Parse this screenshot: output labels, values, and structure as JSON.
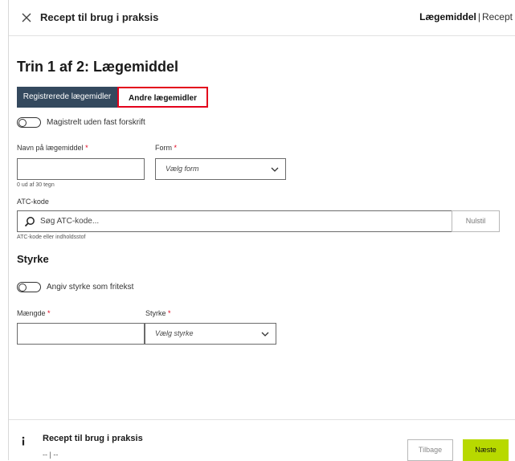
{
  "header": {
    "title": "Recept til brug i praksis",
    "crumb_active": "Lægemiddel",
    "crumb_separator": "|",
    "crumb_next": "Recept"
  },
  "step": {
    "title": "Trin 1 af 2: Lægemiddel"
  },
  "tabs": [
    {
      "label": "Registrerede lægemidler",
      "active": true
    },
    {
      "label": "Andre lægemidler",
      "active": false
    }
  ],
  "magistral_toggle": {
    "label": "Magistrelt uden fast forskrift",
    "on": false
  },
  "name_field": {
    "label": "Navn på lægemiddel",
    "required_mark": "*",
    "value": "",
    "counter": "0 ud af 30 tegn"
  },
  "form_field": {
    "label": "Form",
    "required_mark": "*",
    "placeholder": "Vælg form"
  },
  "atc": {
    "label": "ATC-kode",
    "placeholder": "Søg ATC-kode...",
    "hint": "ATC-kode eller indholdsstof",
    "reset_label": "Nulstil"
  },
  "strength_section": {
    "title": "Styrke"
  },
  "strength_toggle": {
    "label": "Angiv styrke som fritekst",
    "on": false
  },
  "amount_field": {
    "label": "Mængde",
    "required_mark": "*",
    "value": ""
  },
  "strength_field": {
    "label": "Styrke",
    "required_mark": "*",
    "placeholder": "Vælg styrke"
  },
  "footer": {
    "title": "Recept til brug i praksis",
    "subtitle": "-- | --",
    "back_label": "Tilbage",
    "next_label": "Næste"
  },
  "colors": {
    "tab_active_bg": "#34495e",
    "highlight_border": "#e3001b",
    "next_button": "#b8d900",
    "required": "#e3001b"
  }
}
